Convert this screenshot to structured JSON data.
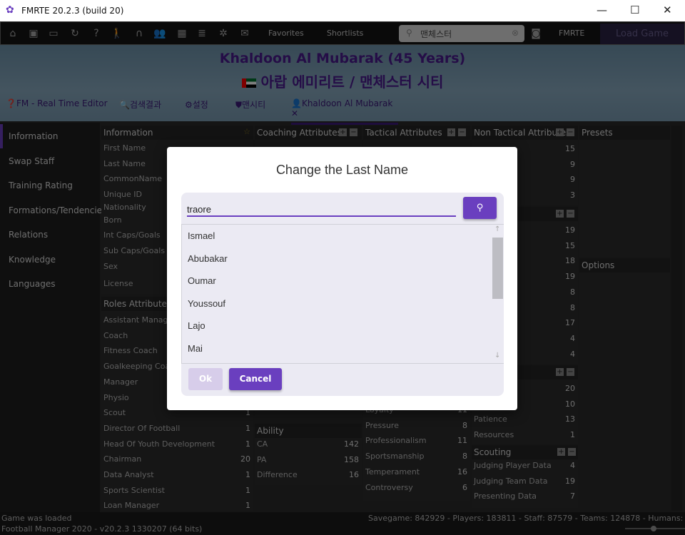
{
  "window": {
    "title": "FMRTE 20.2.3 (build 20)",
    "min": "—",
    "max": "☐",
    "close": "✕"
  },
  "toolbar": {
    "favorites": "Favorites",
    "shortlists": "Shortlists",
    "search_value": "맨체스터",
    "fmrte": "FMRTE",
    "load_game": "Load Game"
  },
  "header": {
    "name": "Khaldoon Al Mubarak (45 Years)",
    "club": "아랍 에미리트 / 맨체스터 시티",
    "tabs": [
      "FM - Real Time Editor",
      "검색결과",
      "설정",
      "맨시티",
      "Khaldoon Al Mubarak"
    ]
  },
  "sidebar": [
    "Information",
    "Swap Staff",
    "Training Rating",
    "Formations/Tendencies",
    "Relations",
    "Knowledge",
    "Languages"
  ],
  "panels": {
    "information": {
      "title": "Information",
      "rows": [
        "First Name",
        "Last Name",
        "CommonName",
        "Unique ID",
        "Nationality",
        "Born",
        "Int Caps/Goals",
        "Sub Caps/Goals",
        "Sex",
        "License"
      ]
    },
    "roles": {
      "title": "Roles Attributes",
      "rows": [
        [
          "Assistant Manager",
          ""
        ],
        [
          "Coach",
          ""
        ],
        [
          "Fitness Coach",
          ""
        ],
        [
          "Goalkeeping Coach",
          ""
        ],
        [
          "Manager",
          ""
        ],
        [
          "Physio",
          ""
        ],
        [
          "Scout",
          "1"
        ],
        [
          "Director Of Football",
          "1"
        ],
        [
          "Head Of Youth Development",
          "1"
        ],
        [
          "Chairman",
          "20"
        ],
        [
          "Data Analyst",
          "1"
        ],
        [
          "Sports Scientist",
          "1"
        ],
        [
          "Loan Manager",
          "1"
        ]
      ]
    },
    "coaching": {
      "title": "Coaching Attributes"
    },
    "ability": {
      "title": "Ability",
      "rows": [
        [
          "CA",
          "142"
        ],
        [
          "PA",
          "158"
        ],
        [
          "Difference",
          "16"
        ]
      ]
    },
    "tactical": {
      "title": "Tactical Attributes",
      "rows": [
        [
          "Loyalty",
          "11"
        ],
        [
          "Pressure",
          "8"
        ],
        [
          "Professionalism",
          "11"
        ],
        [
          "Sportsmanship",
          "8"
        ],
        [
          "Temperament",
          "16"
        ],
        [
          "Controversy",
          "6"
        ]
      ]
    },
    "non_tactical": {
      "title": "Non Tactical Attributes",
      "values": [
        "15",
        "9",
        "9",
        "3"
      ]
    },
    "mental": {
      "values": [
        "19",
        "15",
        "18",
        "19",
        "8",
        "8",
        "17",
        "4",
        "4"
      ]
    },
    "other": {
      "rows": [
        [
          "",
          "20"
        ],
        [
          "",
          "10"
        ],
        [
          "Patience",
          "13"
        ],
        [
          "Resources",
          "1"
        ]
      ]
    },
    "scouting": {
      "title": "Scouting",
      "rows": [
        [
          "Judging Player Data",
          "4"
        ],
        [
          "Judging Team Data",
          "19"
        ],
        [
          "Presenting Data",
          "7"
        ]
      ]
    },
    "presets": {
      "title": "Presets"
    },
    "options": {
      "title": "Options"
    }
  },
  "status": {
    "left1": "Game was loaded",
    "left2": "Football Manager 2020 - v20.2.3 1330207  (64 bits)",
    "right": "Savegame: 842929 - Players: 183811 - Staff: 87579 - Teams: 124878 - Humans: 1"
  },
  "dialog": {
    "title": "Change the Last Name",
    "input": "traore",
    "results": [
      "Ismael",
      "Abubakar",
      "Oumar",
      "Youssouf",
      "Lajo",
      "Mai"
    ],
    "ok": "Ok",
    "cancel": "Cancel"
  },
  "colors": {
    "accent": "#6a3fbf",
    "header_text": "#4b1a8f"
  }
}
